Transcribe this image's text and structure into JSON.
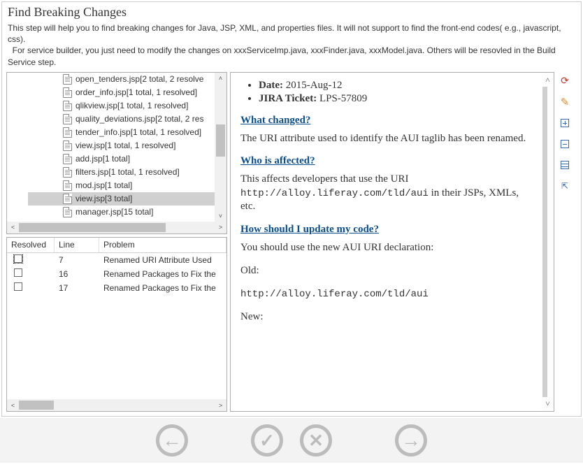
{
  "header": {
    "title": "Find Breaking Changes",
    "desc1": "This step will help you to find breaking changes for Java, JSP, XML, and properties files. It will not support to find the front-end codes( e.g., javascript, css).",
    "desc2": "  For service builder, you just need to modify the changes on xxxServiceImp.java, xxxFinder.java, xxxModel.java. Others will be resovled in the Build Service step."
  },
  "tree": {
    "items": [
      {
        "label": "open_tenders.jsp[2 total, 2 resolve",
        "selected": false
      },
      {
        "label": "order_info.jsp[1 total, 1 resolved]",
        "selected": false
      },
      {
        "label": "qlikview.jsp[1 total, 1 resolved]",
        "selected": false
      },
      {
        "label": "quality_deviations.jsp[2 total, 2 res",
        "selected": false
      },
      {
        "label": "tender_info.jsp[1 total, 1 resolved]",
        "selected": false
      },
      {
        "label": "view.jsp[1 total, 1 resolved]",
        "selected": false
      },
      {
        "label": "add.jsp[1 total]",
        "selected": false
      },
      {
        "label": "filters.jsp[1 total, 1 resolved]",
        "selected": false
      },
      {
        "label": "mod.jsp[1 total]",
        "selected": false
      },
      {
        "label": "view.jsp[3 total]",
        "selected": true
      },
      {
        "label": "manager.jsp[15 total]",
        "selected": false
      }
    ]
  },
  "table": {
    "cols": {
      "resolved": "Resolved",
      "line": "Line",
      "problem": "Problem"
    },
    "rows": [
      {
        "resolved": false,
        "line": "7",
        "problem": "Renamed URI Attribute Used",
        "sel": true
      },
      {
        "resolved": false,
        "line": "16",
        "problem": "Renamed Packages to Fix the",
        "sel": false
      },
      {
        "resolved": false,
        "line": "17",
        "problem": "Renamed Packages to Fix the",
        "sel": false
      }
    ]
  },
  "detail": {
    "date_label": "Date:",
    "date_value": "2015-Aug-12",
    "jira_label": "JIRA Ticket:",
    "jira_value": "LPS-57809",
    "h_whatchanged": "What changed?",
    "p_whatchanged": "The URI attribute used to identify the AUI taglib has been renamed.",
    "h_whoaffected": "Who is affected?",
    "p_whoaffected_pre": "This affects developers that use the URI ",
    "p_whoaffected_code": "http://alloy.liferay.com/tld/aui",
    "p_whoaffected_post": " in their JSPs, XMLs, etc.",
    "h_howupdate": "How should I update my code?",
    "p_howupdate": "You should use the new AUI URI declaration:",
    "old_label": "Old:",
    "old_code": "http://alloy.liferay.com/tld/aui",
    "new_label": "New:"
  },
  "sidebar": {
    "btn1": "refresh-icon",
    "btn2": "wand-icon",
    "btn3": "expand-all-icon",
    "btn4": "collapse-all-icon",
    "btn5": "list-icon",
    "btn6": "link-icon"
  },
  "footer": {
    "back": "back-button",
    "ok": "apply-button",
    "cancel": "cancel-button",
    "next": "next-button"
  }
}
